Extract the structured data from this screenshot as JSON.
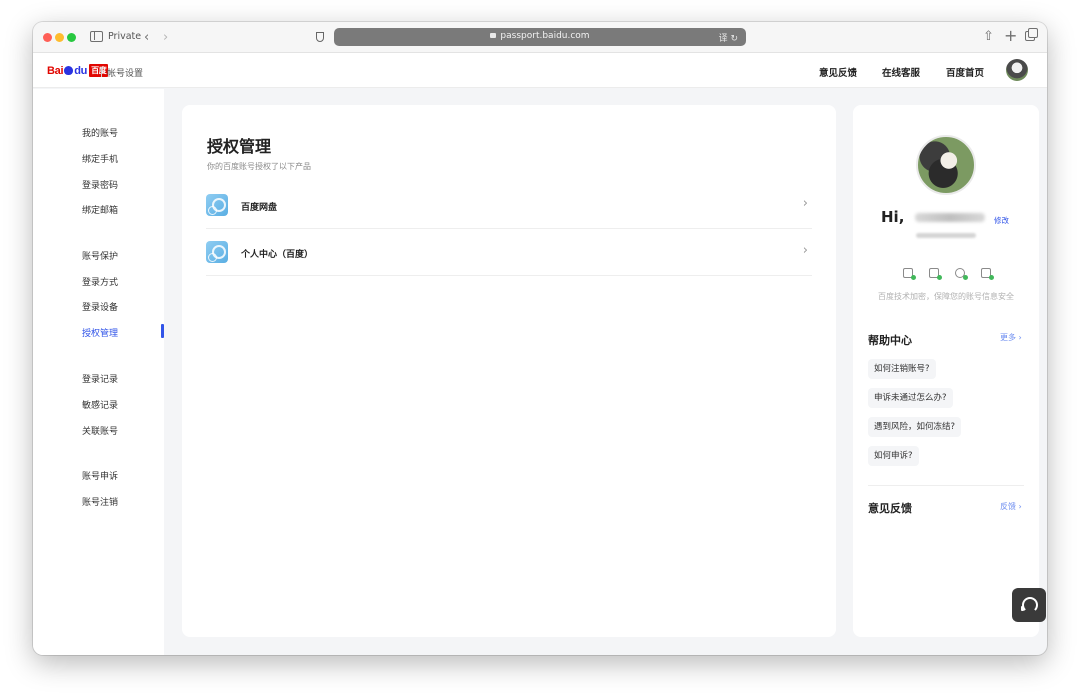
{
  "browser": {
    "private_label": "Private",
    "url": "passport.baidu.com",
    "translate_label": "译"
  },
  "header": {
    "logo_bai": "Bai",
    "logo_du": "du",
    "logo_cn": "百度",
    "title": "帐号设置",
    "nav": [
      "意见反馈",
      "在线客服",
      "百度首页"
    ]
  },
  "sidebar": {
    "items": [
      {
        "label": "我的账号"
      },
      {
        "label": "绑定手机"
      },
      {
        "label": "登录密码"
      },
      {
        "label": "绑定邮箱"
      },
      {
        "label": "账号保护"
      },
      {
        "label": "登录方式"
      },
      {
        "label": "登录设备"
      },
      {
        "label": "授权管理",
        "active": true
      },
      {
        "label": "登录记录"
      },
      {
        "label": "敏感记录"
      },
      {
        "label": "关联账号"
      },
      {
        "label": "账号申诉"
      },
      {
        "label": "账号注销"
      }
    ]
  },
  "main": {
    "title": "授权管理",
    "subtitle": "你的百度账号授权了以下产品",
    "apps": [
      {
        "name": "百度网盘"
      },
      {
        "name": "个人中心（百度）"
      }
    ],
    "chevron": "›"
  },
  "profile": {
    "greeting": "Hi,",
    "edit_label": "修改",
    "security_text": "百度技术加密，保障您的账号信息安全"
  },
  "help": {
    "title": "帮助中心",
    "more_label": "更多 ›",
    "questions": [
      "如何注销账号?",
      "申诉未通过怎么办?",
      "遇到风险，如何冻结?",
      "如何申诉?"
    ]
  },
  "feedback": {
    "title": "意见反馈",
    "link_label": "反馈 ›"
  },
  "colors": {
    "accent": "#3154e8",
    "baidu_red": "#e10601",
    "baidu_blue": "#2932e1"
  }
}
